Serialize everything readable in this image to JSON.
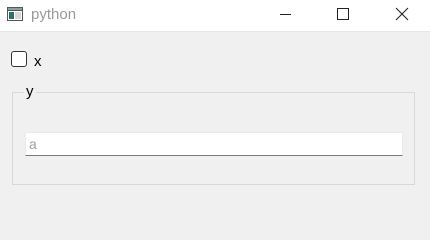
{
  "window": {
    "title": "python",
    "icon": "python-app-icon",
    "controls": {
      "minimize_icon": "minimize-icon",
      "maximize_icon": "maximize-icon",
      "close_icon": "close-icon"
    }
  },
  "checkbox": {
    "label": "x",
    "checked": false
  },
  "group": {
    "title": "y",
    "input": {
      "placeholder": "a",
      "value": ""
    }
  },
  "colors": {
    "window_bg": "#f0f0f0",
    "titlebar_bg": "#ffffff",
    "title_text": "#9a9a9a"
  }
}
